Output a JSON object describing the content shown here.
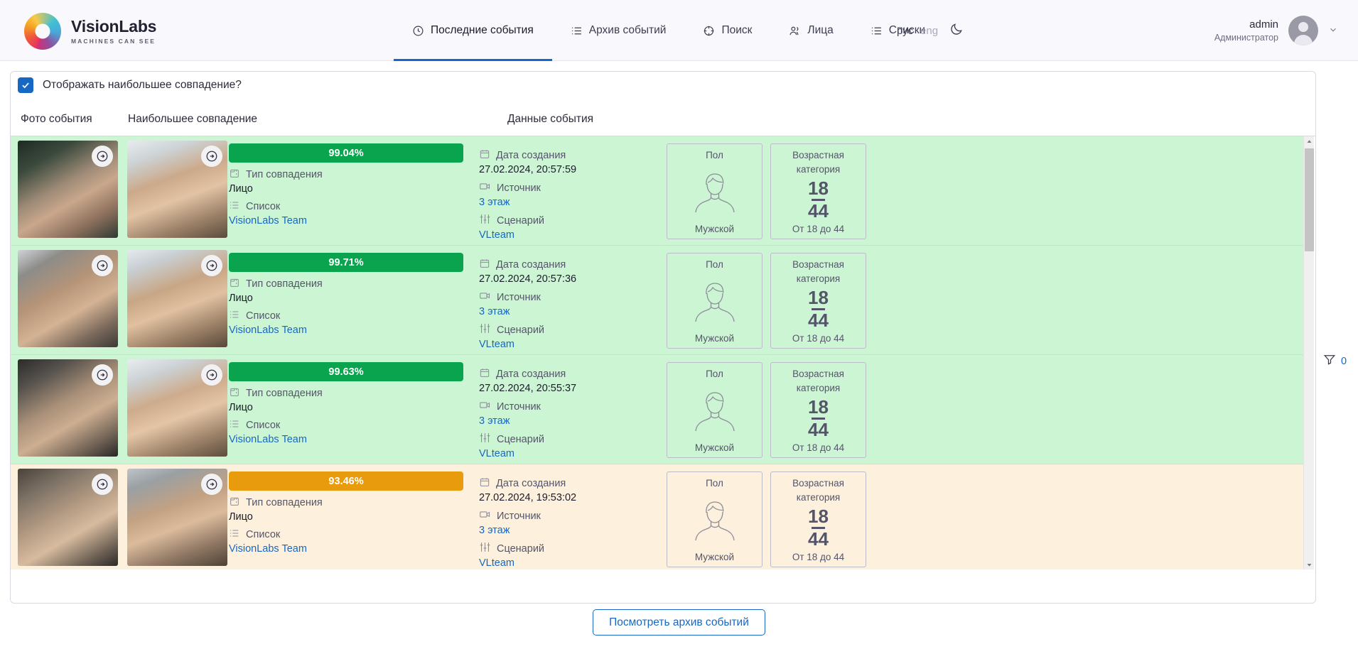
{
  "brand": {
    "name": "VisionLabs",
    "tagline": "MACHINES CAN SEE",
    "logo_icon": "visionlabs-ring-logo"
  },
  "nav": {
    "items": [
      {
        "label": "Последние события",
        "icon": "clock-icon",
        "active": true
      },
      {
        "label": "Архив событий",
        "icon": "list-icon",
        "active": false
      },
      {
        "label": "Поиск",
        "icon": "target-search-icon",
        "active": false
      },
      {
        "label": "Лица",
        "icon": "people-icon",
        "active": false
      },
      {
        "label": "Списки",
        "icon": "list-bullet-icon",
        "active": false
      }
    ],
    "lang": {
      "ru": "рус",
      "en": "eng",
      "active": "ru"
    },
    "theme_icon": "moon-icon"
  },
  "user": {
    "name": "admin",
    "role": "Администратор",
    "avatar_icon": "user-avatar-icon",
    "chevron_icon": "chevron-down-icon"
  },
  "filters": {
    "checkbox_label": "Отображать наибольшее совпадение?",
    "checked": true
  },
  "columns": {
    "photo": "Фото события",
    "match": "Наибольшее совпадение",
    "data": "Данные события"
  },
  "labels": {
    "match_type": "Тип совпадения",
    "list": "Список",
    "created": "Дата создания",
    "source": "Источник",
    "scenario": "Сценарий",
    "gender_title": "Пол",
    "age_title": "Возрастная категория"
  },
  "colors": {
    "accent": "#1767c4",
    "score_high": "#0aa44f",
    "score_mid": "#e89b0c",
    "row_high_bg": "#ccf5d4",
    "row_mid_bg": "#fdf0dc"
  },
  "rows": [
    {
      "score": "99.04%",
      "tone": "green",
      "match_type": "Лицо",
      "list": "VisionLabs Team",
      "created": "27.02.2024, 20:57:59",
      "source": "3 этаж",
      "scenario": "VLteam",
      "gender": "Мужской",
      "age_from": "18",
      "age_to": "44",
      "age_range": "От 18 до 44"
    },
    {
      "score": "99.71%",
      "tone": "green",
      "match_type": "Лицо",
      "list": "VisionLabs Team",
      "created": "27.02.2024, 20:57:36",
      "source": "3 этаж",
      "scenario": "VLteam",
      "gender": "Мужской",
      "age_from": "18",
      "age_to": "44",
      "age_range": "От 18 до 44"
    },
    {
      "score": "99.63%",
      "tone": "green",
      "match_type": "Лицо",
      "list": "VisionLabs Team",
      "created": "27.02.2024, 20:55:37",
      "source": "3 этаж",
      "scenario": "VLteam",
      "gender": "Мужской",
      "age_from": "18",
      "age_to": "44",
      "age_range": "От 18 до 44"
    },
    {
      "score": "93.46%",
      "tone": "orange",
      "match_type": "Лицо",
      "list": "VisionLabs Team",
      "created": "27.02.2024, 19:53:02",
      "source": "3 этаж",
      "scenario": "VLteam",
      "gender": "Мужской",
      "age_from": "18",
      "age_to": "44",
      "age_range": "От 18 до 44"
    }
  ],
  "sidebar_filter": {
    "count": "0",
    "icon": "funnel-filter-icon"
  },
  "footer": {
    "archive_button": "Посмотреть архив событий"
  },
  "scrollbar": {
    "up_icon": "scroll-up-arrow-icon",
    "down_icon": "scroll-down-arrow-icon"
  }
}
